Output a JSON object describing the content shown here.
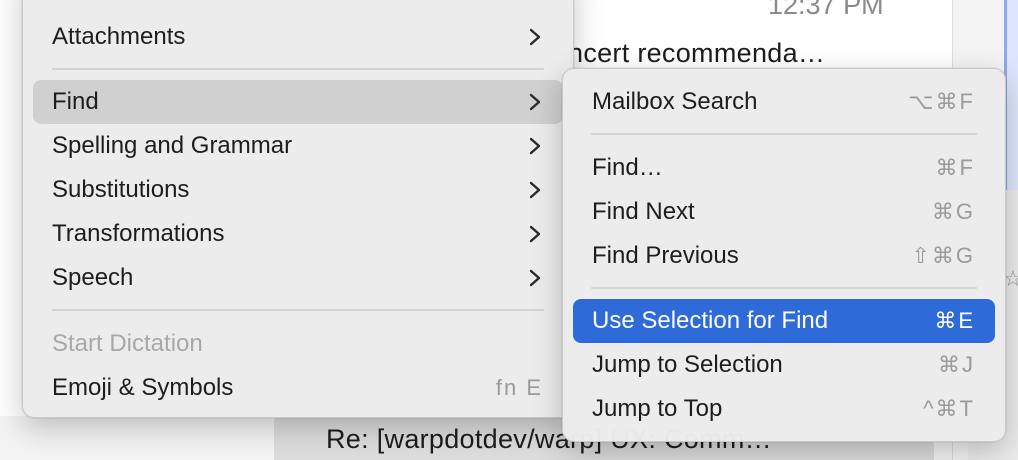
{
  "background": {
    "time": "12:37 PM",
    "subject": "ncert recommenda…",
    "row_subject": "Re: [warpdotdev/warp] UX: Comm…",
    "star_icon": "star-icon"
  },
  "main_menu": {
    "items": [
      {
        "label": "Attachments",
        "submenu": true
      },
      {
        "label": "Find",
        "submenu": true,
        "state": "hover"
      },
      {
        "label": "Spelling and Grammar",
        "submenu": true
      },
      {
        "label": "Substitutions",
        "submenu": true
      },
      {
        "label": "Transformations",
        "submenu": true
      },
      {
        "label": "Speech",
        "submenu": true
      },
      {
        "label": "Start Dictation",
        "disabled": true
      },
      {
        "label": "Emoji & Symbols",
        "shortcut": "fn E"
      }
    ]
  },
  "find_submenu": {
    "items": [
      {
        "label": "Mailbox Search",
        "shortcut": "⌥⌘F"
      },
      {
        "label": "Find…",
        "shortcut": "⌘F"
      },
      {
        "label": "Find Next",
        "shortcut": "⌘G"
      },
      {
        "label": "Find Previous",
        "shortcut": "⇧⌘G"
      },
      {
        "label": "Use Selection for Find",
        "shortcut": "⌘E",
        "state": "selected"
      },
      {
        "label": "Jump to Selection",
        "shortcut": "⌘J"
      },
      {
        "label": "Jump to Top",
        "shortcut": "^⌘T"
      }
    ]
  },
  "colors": {
    "selection": "#2f6ad9",
    "hover": "#d0d0d0",
    "menu_bg": "#ececec"
  }
}
